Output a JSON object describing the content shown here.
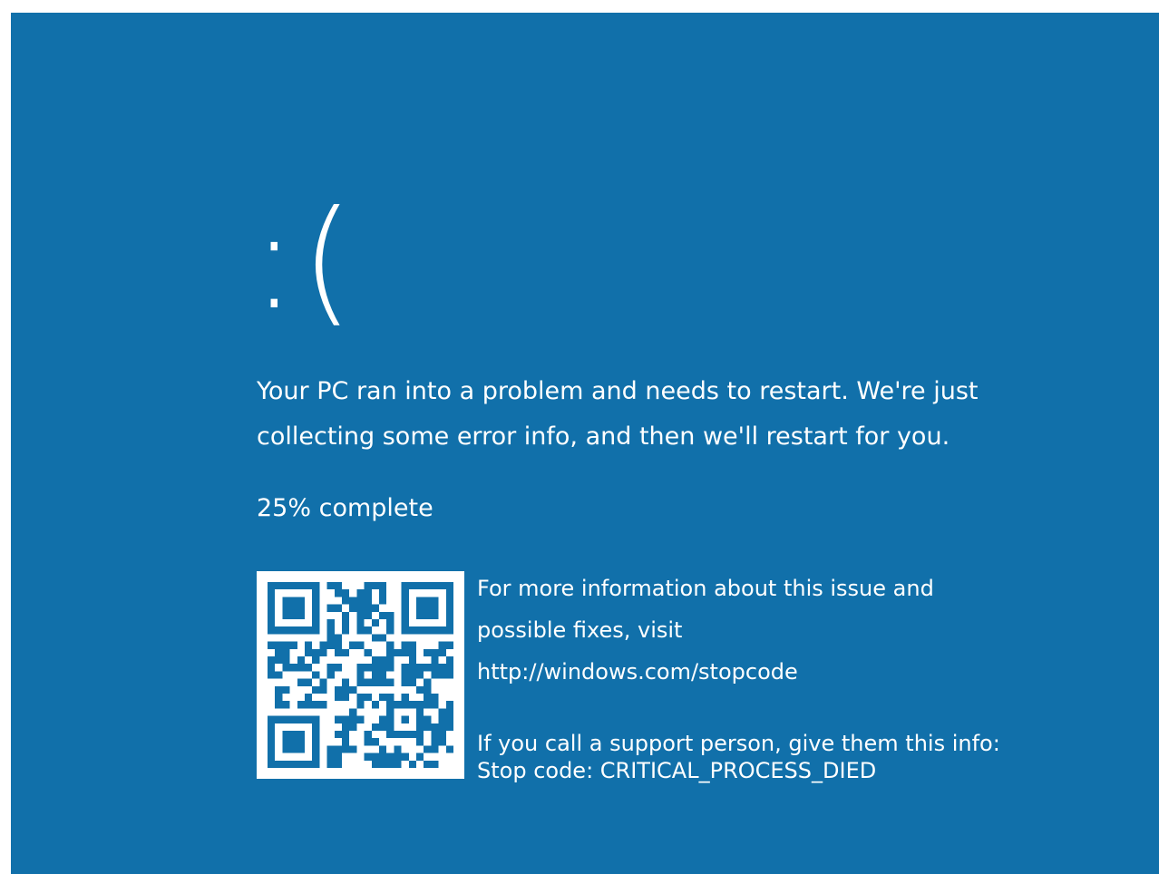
{
  "screen": {
    "background_color": "#1170aa",
    "text_color": "#ffffff"
  },
  "sad_face": ":(",
  "main_message": "Your PC ran into a problem and needs to restart. We're just collecting some error info, and then we'll restart for you.",
  "progress": {
    "percent": 25,
    "text": "25% complete"
  },
  "qr_code": {
    "icon": "qr-code-icon"
  },
  "info": {
    "line1": "For more information about this issue and",
    "line2": "possible fixes, visit",
    "link": "http://windows.com/stopcode",
    "support_text": "If you call a support person, give them this info:",
    "stop_code_label": "Stop code:",
    "stop_code": "CRITICAL_PROCESS_DIED"
  }
}
